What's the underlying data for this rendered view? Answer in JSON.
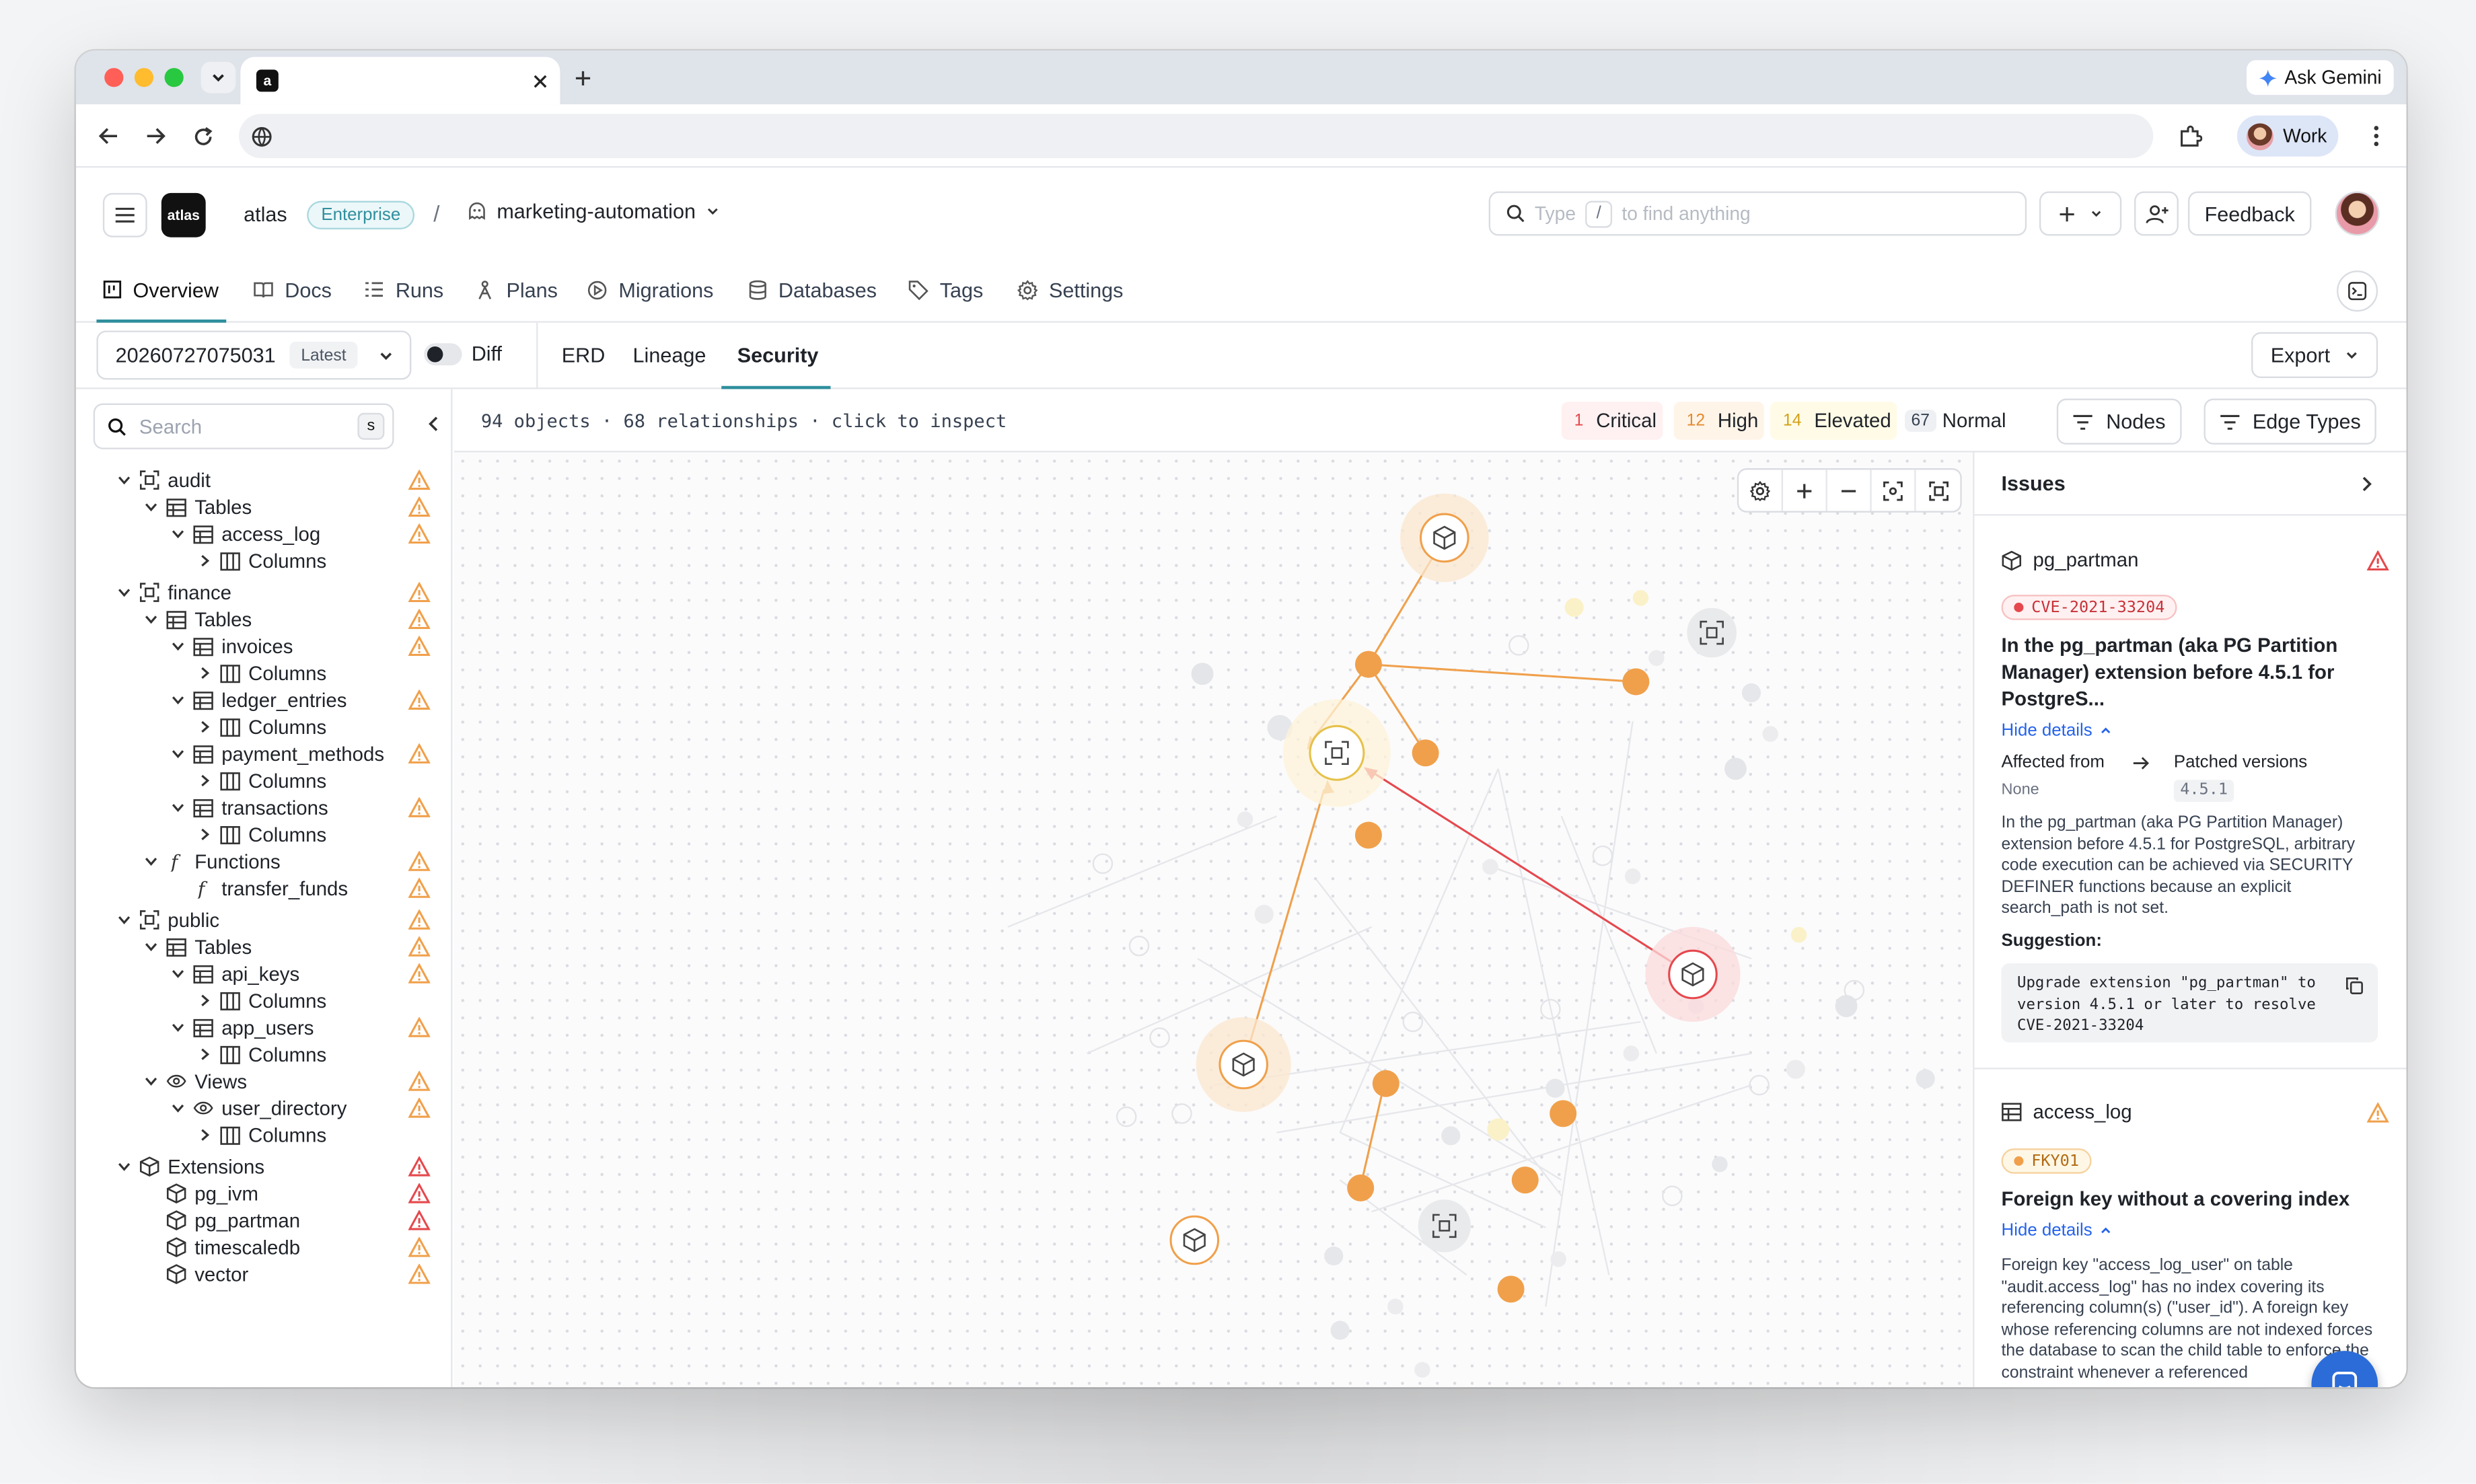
{
  "browser": {
    "ask_gemini": "Ask Gemini",
    "profile": "Work",
    "tab_favicon": "a"
  },
  "app": {
    "logo": "atlas",
    "org": "atlas",
    "plan_badge": "Enterprise",
    "separator": "/",
    "project": "marketing-automation",
    "search_placeholder_pre": "Type",
    "search_key": "/",
    "search_placeholder_post": "to find anything",
    "feedback": "Feedback"
  },
  "nav": {
    "items": [
      {
        "label": "Overview",
        "icon": "overview-icon"
      },
      {
        "label": "Docs",
        "icon": "docs-icon"
      },
      {
        "label": "Runs",
        "icon": "runs-icon"
      },
      {
        "label": "Plans",
        "icon": "plans-icon"
      },
      {
        "label": "Migrations",
        "icon": "migrations-icon"
      },
      {
        "label": "Databases",
        "icon": "databases-icon"
      },
      {
        "label": "Tags",
        "icon": "tags-icon"
      },
      {
        "label": "Settings",
        "icon": "settings-icon"
      }
    ]
  },
  "subbar": {
    "version": "20260727075031",
    "version_badge": "Latest",
    "diff_label": "Diff",
    "views": [
      "ERD",
      "Lineage",
      "Security"
    ],
    "active_view": "Security",
    "export": "Export"
  },
  "sidebar": {
    "search_placeholder": "Search",
    "search_key": "s",
    "tree": [
      {
        "label": "audit",
        "level": 0,
        "kind": "schema",
        "chev": "down",
        "warn": "orange"
      },
      {
        "label": "Tables",
        "level": 1,
        "kind": "tables",
        "chev": "down",
        "warn": "orange"
      },
      {
        "label": "access_log",
        "level": 2,
        "kind": "table",
        "chev": "down",
        "warn": "orange"
      },
      {
        "label": "Columns",
        "level": 3,
        "kind": "columns",
        "chev": "right",
        "warn": ""
      },
      {
        "label": "finance",
        "level": 0,
        "kind": "schema",
        "chev": "down",
        "warn": "orange"
      },
      {
        "label": "Tables",
        "level": 1,
        "kind": "tables",
        "chev": "down",
        "warn": "orange"
      },
      {
        "label": "invoices",
        "level": 2,
        "kind": "table",
        "chev": "down",
        "warn": "orange"
      },
      {
        "label": "Columns",
        "level": 3,
        "kind": "columns",
        "chev": "right",
        "warn": ""
      },
      {
        "label": "ledger_entries",
        "level": 2,
        "kind": "table",
        "chev": "down",
        "warn": "orange"
      },
      {
        "label": "Columns",
        "level": 3,
        "kind": "columns",
        "chev": "right",
        "warn": ""
      },
      {
        "label": "payment_methods",
        "level": 2,
        "kind": "table",
        "chev": "down",
        "warn": "orange"
      },
      {
        "label": "Columns",
        "level": 3,
        "kind": "columns",
        "chev": "right",
        "warn": ""
      },
      {
        "label": "transactions",
        "level": 2,
        "kind": "table",
        "chev": "down",
        "warn": "orange"
      },
      {
        "label": "Columns",
        "level": 3,
        "kind": "columns",
        "chev": "right",
        "warn": ""
      },
      {
        "label": "Functions",
        "level": 1,
        "kind": "function",
        "chev": "down",
        "warn": "orange"
      },
      {
        "label": "transfer_funds",
        "level": 2,
        "kind": "function",
        "chev": "",
        "warn": "orange"
      },
      {
        "label": "public",
        "level": 0,
        "kind": "schema",
        "chev": "down",
        "warn": "orange"
      },
      {
        "label": "Tables",
        "level": 1,
        "kind": "tables",
        "chev": "down",
        "warn": "orange"
      },
      {
        "label": "api_keys",
        "level": 2,
        "kind": "table",
        "chev": "down",
        "warn": "orange"
      },
      {
        "label": "Columns",
        "level": 3,
        "kind": "columns",
        "chev": "right",
        "warn": ""
      },
      {
        "label": "app_users",
        "level": 2,
        "kind": "table",
        "chev": "down",
        "warn": "orange"
      },
      {
        "label": "Columns",
        "level": 3,
        "kind": "columns",
        "chev": "right",
        "warn": ""
      },
      {
        "label": "Views",
        "level": 1,
        "kind": "view",
        "chev": "down",
        "warn": "orange"
      },
      {
        "label": "user_directory",
        "level": 2,
        "kind": "view",
        "chev": "down",
        "warn": "orange"
      },
      {
        "label": "Columns",
        "level": 3,
        "kind": "columns",
        "chev": "right",
        "warn": ""
      },
      {
        "label": "Extensions",
        "level": 0,
        "kind": "extension",
        "chev": "down",
        "warn": "red"
      },
      {
        "label": "pg_ivm",
        "level": 1,
        "kind": "extension",
        "chev": "",
        "warn": "red"
      },
      {
        "label": "pg_partman",
        "level": 1,
        "kind": "extension",
        "chev": "",
        "warn": "red"
      },
      {
        "label": "timescaledb",
        "level": 1,
        "kind": "extension",
        "chev": "",
        "warn": "orange"
      },
      {
        "label": "vector",
        "level": 1,
        "kind": "extension",
        "chev": "",
        "warn": "orange"
      }
    ]
  },
  "canvas": {
    "summary": "94 objects · 68 relationships · click to inspect",
    "severity": [
      {
        "count": "1",
        "label": "Critical",
        "color": "#e5484d"
      },
      {
        "count": "12",
        "label": "High",
        "color": "#f0a04b"
      },
      {
        "count": "14",
        "label": "Elevated",
        "color": "#e3b341"
      },
      {
        "count": "67",
        "label": "Normal",
        "color": "#6b7280"
      }
    ],
    "nodes_btn": "Nodes",
    "edge_types_btn": "Edge Types"
  },
  "issues": {
    "title": "Issues",
    "cards": [
      {
        "object": "pg_partman",
        "object_icon": "cube-icon",
        "severity": "red",
        "code": "CVE-2021-33204",
        "title": "In the pg_partman (aka PG Partition Manager) extension before 4.5.1 for PostgreS...",
        "toggle": "Hide details",
        "affected_label": "Affected from",
        "patched_label": "Patched versions",
        "affected_value": "None",
        "patched_value": "4.5.1",
        "description": "In the pg_partman (aka PG Partition Manager) extension before 4.5.1 for PostgreSQL, arbitrary code execution can be achieved via SECURITY DEFINER functions because an explicit search_path is not set.",
        "suggestion_label": "Suggestion:",
        "suggestion": "Upgrade extension \"pg_partman\" to version 4.5.1 or later to resolve CVE-2021-33204"
      },
      {
        "object": "access_log",
        "object_icon": "table-icon",
        "severity": "orange",
        "code": "FKY01",
        "title": "Foreign key without a covering index",
        "toggle": "Hide details",
        "description": "Foreign key \"access_log_user\" on table \"audit.access_log\" has no index covering its referencing column(s) (\"user_id\"). A foreign key whose referencing columns are not indexed forces the database to scan the child table to enforce the constraint whenever a referenced"
      }
    ]
  },
  "colors": {
    "accent": "#2f8f9d",
    "node_orange": "#f0a04b",
    "edge_red": "#e5484d",
    "warn_orange": "#f0a04b",
    "warn_red": "#e5484d",
    "link_blue": "#2563eb"
  }
}
